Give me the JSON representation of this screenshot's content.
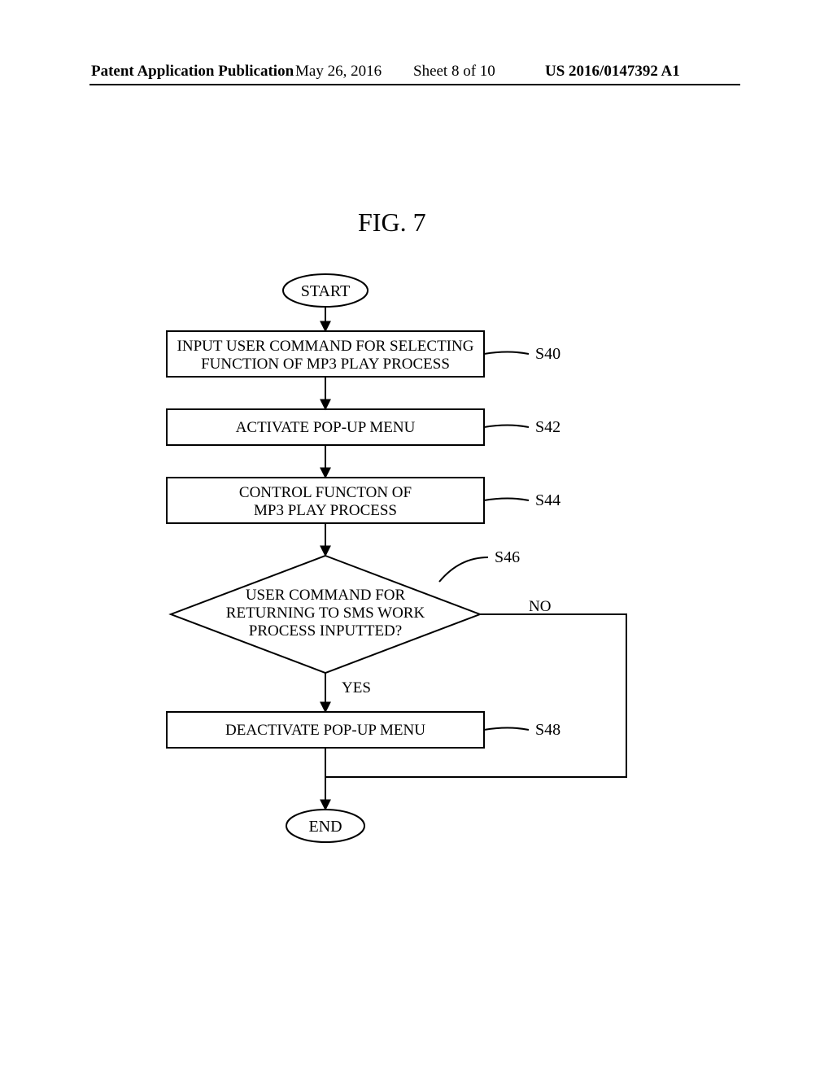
{
  "header": {
    "left": "Patent Application Publication",
    "date": "May 26, 2016",
    "sheet": "Sheet 8 of 10",
    "pubno": "US 2016/0147392 A1"
  },
  "figure": {
    "title": "FIG. 7",
    "start": "START",
    "end": "END",
    "steps": {
      "s40": {
        "label": "S40",
        "text1": "INPUT USER COMMAND FOR SELECTING",
        "text2": "FUNCTION OF MP3 PLAY PROCESS"
      },
      "s42": {
        "label": "S42",
        "text1": "ACTIVATE POP-UP MENU"
      },
      "s44": {
        "label": "S44",
        "text1": "CONTROL FUNCTON OF",
        "text2": "MP3 PLAY PROCESS"
      },
      "s46": {
        "label": "S46",
        "text1": "USER COMMAND FOR",
        "text2": "RETURNING TO SMS WORK",
        "text3": "PROCESS INPUTTED?"
      },
      "s48": {
        "label": "S48",
        "text1": "DEACTIVATE POP-UP MENU"
      }
    },
    "branches": {
      "yes": "YES",
      "no": "NO"
    }
  },
  "chart_data": {
    "type": "flowchart",
    "nodes": [
      {
        "id": "start",
        "shape": "terminator",
        "text": "START"
      },
      {
        "id": "s40",
        "shape": "process",
        "text": "INPUT USER COMMAND FOR SELECTING FUNCTION OF MP3 PLAY PROCESS",
        "label": "S40"
      },
      {
        "id": "s42",
        "shape": "process",
        "text": "ACTIVATE POP-UP MENU",
        "label": "S42"
      },
      {
        "id": "s44",
        "shape": "process",
        "text": "CONTROL FUNCTON OF MP3 PLAY PROCESS",
        "label": "S44"
      },
      {
        "id": "s46",
        "shape": "decision",
        "text": "USER COMMAND FOR RETURNING TO SMS WORK PROCESS INPUTTED?",
        "label": "S46"
      },
      {
        "id": "s48",
        "shape": "process",
        "text": "DEACTIVATE POP-UP MENU",
        "label": "S48"
      },
      {
        "id": "end",
        "shape": "terminator",
        "text": "END"
      }
    ],
    "edges": [
      {
        "from": "start",
        "to": "s40"
      },
      {
        "from": "s40",
        "to": "s42"
      },
      {
        "from": "s42",
        "to": "s44"
      },
      {
        "from": "s44",
        "to": "s46"
      },
      {
        "from": "s46",
        "to": "s48",
        "label": "YES"
      },
      {
        "from": "s46",
        "to": "s44",
        "label": "NO"
      },
      {
        "from": "s48",
        "to": "end"
      }
    ]
  }
}
